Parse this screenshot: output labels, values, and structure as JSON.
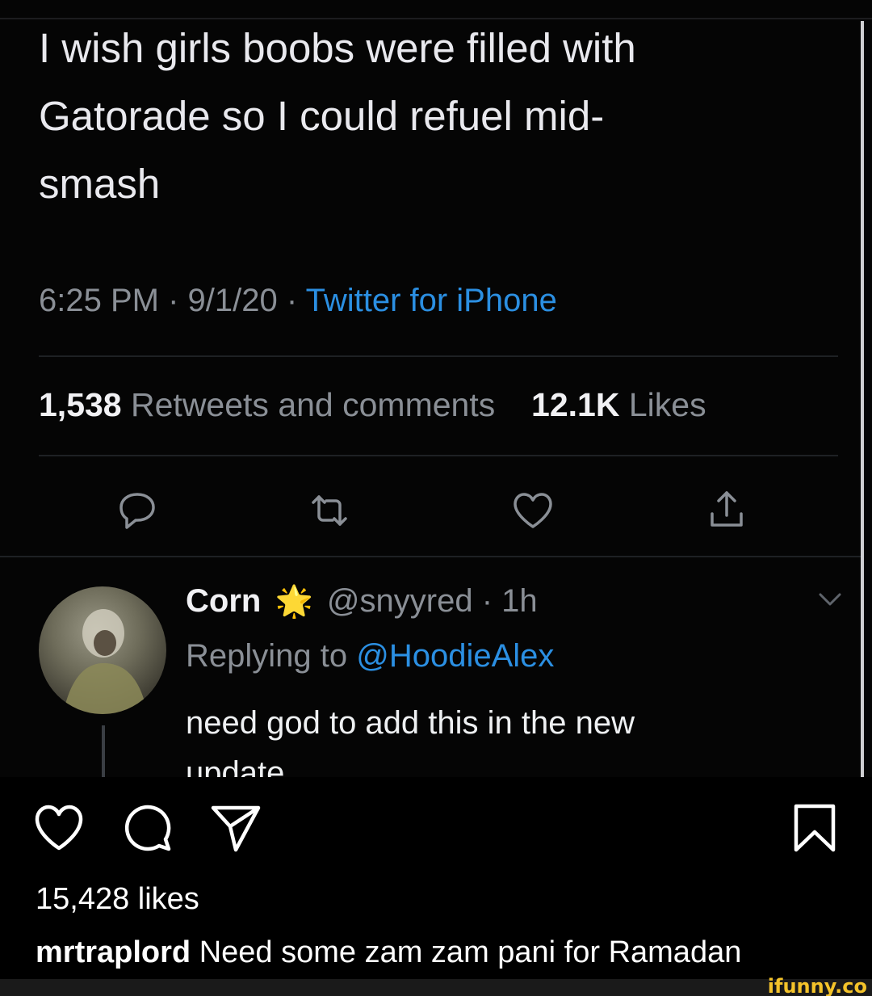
{
  "tweet": {
    "text_line1": "I wish girls boobs were filled with",
    "text_line2": "Gatorade so I could refuel mid-",
    "text_line3": "smash",
    "time": "6:25 PM",
    "date": "9/1/20",
    "source": "Twitter for iPhone",
    "retweets_count": "1,538",
    "retweets_label": "Retweets and comments",
    "likes_count": "12.1K",
    "likes_label": "Likes",
    "actions": [
      "reply-icon",
      "retweet-icon",
      "like-icon",
      "share-icon"
    ]
  },
  "reply": {
    "name": "Corn",
    "badge": "🌟",
    "handle": "@snyyred",
    "time": "1h",
    "replying_prefix": "Replying to",
    "replying_to": "@HoodieAlex",
    "body_line1": "need god to add this in the new",
    "body_line2": "update"
  },
  "instagram": {
    "likes": "15,428 likes",
    "caption_user": "mrtraplord",
    "caption_text": "Need some zam zam pani for Ramadan",
    "actions": [
      "heart-icon",
      "comment-icon",
      "send-icon",
      "bookmark-icon"
    ]
  },
  "watermark": "ifunny.co",
  "colors": {
    "link_blue": "#2b8fe2",
    "muted_gray": "#8a8f96",
    "background": "#000000",
    "watermark_yellow": "#f4c32a"
  }
}
